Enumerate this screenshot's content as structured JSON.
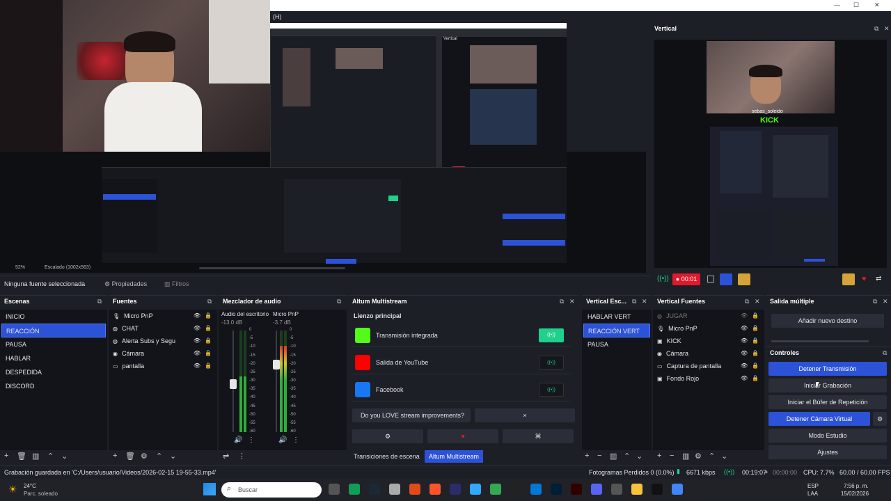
{
  "window": {
    "title": "(H)",
    "min": "—",
    "max": "☐",
    "close": "✕"
  },
  "preview": {
    "mini_mode_label": "Vertical",
    "zoom": "52%",
    "scale": "Escalado (1002x563)",
    "kick_text": "KICK",
    "watermark": "sebas_soleido"
  },
  "vertical_panel": {
    "title": "Vertical",
    "record_time": "00:01"
  },
  "source_bar": {
    "none_selected": "Ninguna fuente seleccionada",
    "properties": "Propiedades",
    "filters": "Filtros"
  },
  "scenes": {
    "title": "Escenas",
    "items": [
      "INICIO",
      "REACCIÓN",
      "PAUSA",
      "HABLAR",
      "DESPEDIDA",
      "DISCORD"
    ],
    "selected_index": 1
  },
  "sources": {
    "title": "Fuentes",
    "items": [
      {
        "label": "Micro PnP",
        "icon": "mic-icon"
      },
      {
        "label": "CHAT",
        "icon": "browser-icon"
      },
      {
        "label": "Alerta Subs y Segu",
        "icon": "browser-icon"
      },
      {
        "label": "Cámara",
        "icon": "camera-icon"
      },
      {
        "label": "pantalla",
        "icon": "display-icon"
      }
    ]
  },
  "mixer": {
    "title": "Mezclador de audio",
    "ch1_name": "Audio del escritorio",
    "ch1_db": "-13.0 dB",
    "ch1_level": 0.55,
    "ch2_name": "Micro PnP",
    "ch2_db": "-3.7 dB",
    "ch2_level": 0.85,
    "scale": [
      "0",
      "-5",
      "-10",
      "-15",
      "-20",
      "-25",
      "-30",
      "-35",
      "-40",
      "-45",
      "-50",
      "-55",
      "-60"
    ]
  },
  "multistream": {
    "title": "Altum Multistream",
    "main_label": "Lienzo principal",
    "destinations": [
      {
        "label": "Transmisión integrada",
        "active": true
      },
      {
        "label": "Salida de YouTube",
        "active": false
      },
      {
        "label": "Facebook",
        "active": false
      }
    ],
    "feedback_q": "Do you LOVE stream improvements?",
    "close": "×"
  },
  "tabs": {
    "transitions": "Transiciones de escena",
    "multistream": "Altum Multistream"
  },
  "vertical_scenes": {
    "title": "Vertical Esc...",
    "items": [
      "HABLAR VERT",
      "REACCIÓN VERT",
      "PAUSA"
    ],
    "selected_index": 1
  },
  "vertical_sources": {
    "title": "Vertical Fuentes",
    "items": [
      {
        "label": "JUGAR",
        "icon": "browser-icon",
        "dim": true
      },
      {
        "label": "Micro PnP",
        "icon": "mic-icon",
        "dim": false
      },
      {
        "label": "KICK",
        "icon": "image-icon",
        "dim": false
      },
      {
        "label": "Cámara",
        "icon": "camera-icon",
        "dim": false
      },
      {
        "label": "Captura de pantalla",
        "icon": "display-icon",
        "dim": false
      },
      {
        "label": "Fondo Rojo",
        "icon": "image-icon",
        "dim": false
      }
    ]
  },
  "multi_output": {
    "title": "Salida múltiple",
    "add_dest": "Añadir nuevo destino"
  },
  "controls": {
    "title": "Controles",
    "stop_stream": "Detener Transmisión",
    "start_rec": "Iniciar Grabación",
    "replay": "Iniciar el Búfer de Repetición",
    "stop_vcam": "Detener Cámara Virtual",
    "studio": "Modo Estudio",
    "settings": "Ajustes"
  },
  "status": {
    "saved": "Grabación guardada en 'C:/Users/usuario/Videos/2026-02-15 19-55-33.mp4'",
    "dropped": "Fotogramas Perdidos 0 (0.0%)",
    "kbps": "6671 kbps",
    "stream_time": "00:19:07",
    "rec_time": "00:00:00",
    "cpu": "CPU: 7.7%",
    "fps": "60.00 / 60.00 FPS"
  },
  "taskbar": {
    "temp": "24°C",
    "weather": "Parc. soleado",
    "search": "Buscar",
    "lang1": "ESP",
    "lang2": "LAA",
    "time": "7:56 p. m.",
    "date": "15/02/2026"
  },
  "colors": {
    "accent": "#2c52d8",
    "green": "#1fd18b",
    "red": "#e0192c",
    "kick": "#53fc18"
  }
}
